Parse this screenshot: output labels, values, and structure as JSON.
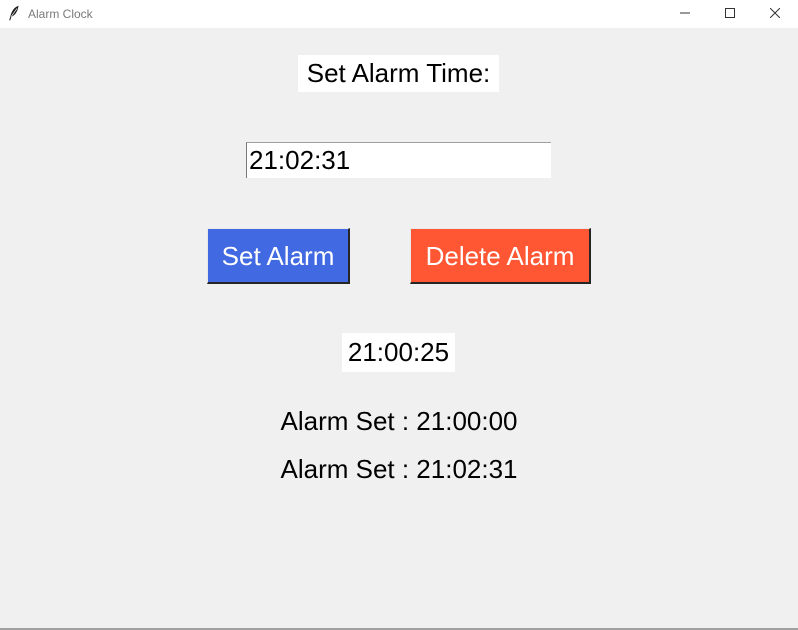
{
  "window": {
    "title": "Alarm Clock",
    "icon": "feather-icon",
    "controls": [
      "minimize-icon",
      "maximize-icon",
      "close-icon"
    ]
  },
  "heading": "Set Alarm Time:",
  "time_input": {
    "value": "21:02:31",
    "placeholder": ""
  },
  "buttons": {
    "set_label": "Set Alarm",
    "delete_label": "Delete Alarm"
  },
  "current_time": "21:00:25",
  "alarms": [
    {
      "label": "Alarm Set : 21:00:00"
    },
    {
      "label": "Alarm Set : 21:02:31"
    }
  ],
  "colors": {
    "set_button": "#4169e1",
    "delete_button": "#ff5733",
    "background": "#f0f0f0"
  }
}
